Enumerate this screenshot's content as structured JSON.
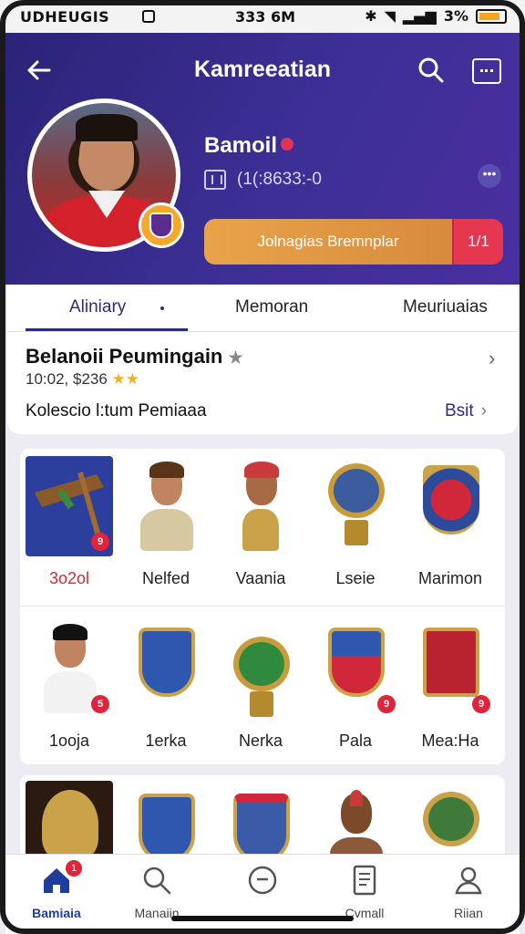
{
  "status_bar": {
    "left_text": "UDHEUGIS",
    "time": "333 6M",
    "battery": "3%"
  },
  "header": {
    "title": "Kamreeatian",
    "profile_name": "Bamoil",
    "profile_sub": "(1(:8633:-0",
    "cta_label": "Jolnagias Bremnplar",
    "cta_alt_label": "1/1"
  },
  "tabs": [
    "Aliniary",
    "Memoran",
    "Meuriuaias"
  ],
  "section": {
    "title": "Belanoii Peumingain",
    "meta": "10:02, $236",
    "collection_label": "Kolescio l:tum Pemiaaa",
    "collection_link": "Bsit"
  },
  "grid_rows": [
    [
      {
        "label": "3o2ol",
        "icon": "club-item-icon",
        "highlight": true,
        "badge": "9"
      },
      {
        "label": "Nelfed",
        "icon": "player-bust-icon"
      },
      {
        "label": "Vaania",
        "icon": "warrior-bust-icon"
      },
      {
        "label": "Lseie",
        "icon": "globe-trophy-icon"
      },
      {
        "label": "Marimon",
        "icon": "crest-shield-icon"
      }
    ],
    [
      {
        "label": "1ooja",
        "icon": "player-portrait-icon",
        "badge": "5"
      },
      {
        "label": "1erka",
        "icon": "blue-shield-icon"
      },
      {
        "label": "Nerka",
        "icon": "green-trophy-icon"
      },
      {
        "label": "Pala",
        "icon": "red-crest-icon",
        "badge": "9"
      },
      {
        "label": "Mea:Ha",
        "icon": "red-shield-icon",
        "badge": "9"
      }
    ],
    [
      {
        "icon": "gold-badge-icon"
      },
      {
        "icon": "blue-crest-icon"
      },
      {
        "icon": "crown-shield-icon"
      },
      {
        "icon": "warrior-figure-icon"
      },
      {
        "icon": "globe-badge-icon"
      }
    ]
  ],
  "bottom_nav": [
    {
      "label": "Bamiaia",
      "icon": "home-icon",
      "active": true,
      "badge": "1"
    },
    {
      "label": "Manaiin",
      "icon": "search-icon"
    },
    {
      "label": "",
      "icon": "minus-circle-icon"
    },
    {
      "label": "Cvmall",
      "icon": "document-icon"
    },
    {
      "label": "Riian",
      "icon": "profile-icon"
    }
  ],
  "colors": {
    "header_start": "#2a2478",
    "header_end": "#4a2fa0",
    "cta_orange": "#e8a44a",
    "cta_red": "#e5374f",
    "accent": "#2c2a7a",
    "badge_red": "#e0243a"
  }
}
